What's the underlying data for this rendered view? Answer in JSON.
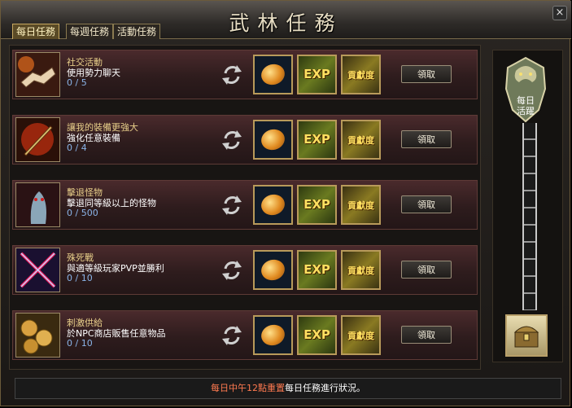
{
  "window": {
    "title": "武林任務",
    "close_label": "×"
  },
  "tabs": [
    {
      "label": "每日任務",
      "active": true
    },
    {
      "label": "每週任務",
      "active": false
    },
    {
      "label": "活動任務",
      "active": false
    }
  ],
  "quests": [
    {
      "title": "社交活動",
      "desc": "使用勢力聊天",
      "progress": "0 / 5",
      "icon": "handshake-icon",
      "claim": "領取"
    },
    {
      "title": "讓我的裝備更強大",
      "desc": "強化任意裝備",
      "progress": "0 / 4",
      "icon": "sword-forge-icon",
      "claim": "領取"
    },
    {
      "title": "擊退怪物",
      "desc": "擊退同等級以上的怪物",
      "progress": "0 / 500",
      "icon": "monster-icon",
      "claim": "領取"
    },
    {
      "title": "殊死戰",
      "desc": "與適等級玩家PVP並勝利",
      "progress": "0 / 10",
      "icon": "crossed-swords-icon",
      "claim": "領取"
    },
    {
      "title": "刺激供給",
      "desc": "於NPC商店販售任意物品",
      "progress": "0 / 10",
      "icon": "coins-icon",
      "claim": "領取"
    }
  ],
  "reward_labels": {
    "exp": "EXP",
    "contribution": "貢獻度"
  },
  "side": {
    "label_line1": "每日",
    "label_line2": "活躍"
  },
  "footer": {
    "highlight": "每日中午12點重置",
    "text": "每日任務進行狀況。"
  }
}
